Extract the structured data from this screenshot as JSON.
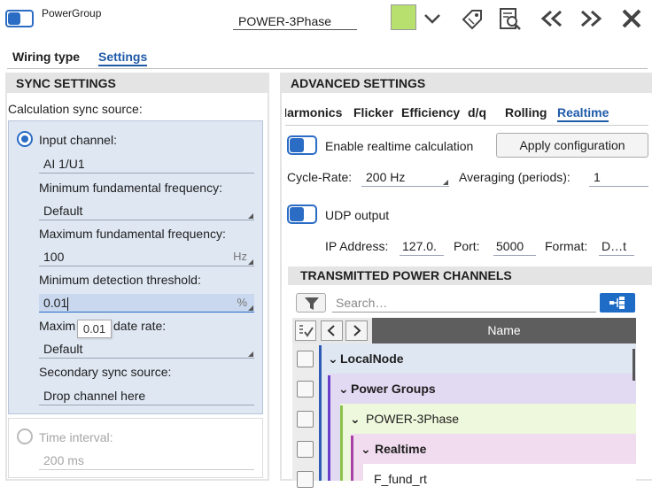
{
  "header": {
    "group_title": "PowerGroup",
    "name_value": "POWER-3Phase",
    "swatch_color": "#b8e06e"
  },
  "tabs": [
    "Wiring type",
    "Settings"
  ],
  "sync": {
    "title": "SYNC SETTINGS",
    "source_label": "Calculation sync source:",
    "input_channel_label": "Input channel:",
    "input_channel_value": "AI 1/U1",
    "min_freq_label": "Minimum fundamental frequency:",
    "min_freq_value": "Default",
    "max_freq_label": "Maximum fundamental frequency:",
    "max_freq_value": "100",
    "max_freq_unit": "Hz",
    "min_thresh_label": "Minimum detection threshold:",
    "min_thresh_value": "0.01",
    "min_thresh_unit": "%",
    "tooltip": "0.01",
    "update_rate_label_a": "Maxim",
    "update_rate_label_b": "date rate:",
    "update_rate_value": "Default",
    "secondary_label": "Secondary sync source:",
    "secondary_value": "Drop channel here",
    "time_interval_label": "Time interval:",
    "time_interval_value": "200 ms"
  },
  "advanced": {
    "title": "ADVANCED SETTINGS",
    "tabs": [
      "Harmonics",
      "Flicker",
      "Efficiency",
      "d/q",
      "Rolling",
      "Realtime"
    ],
    "active_tab": "Realtime",
    "enable_label": "Enable realtime calculation",
    "apply_button": "Apply configuration",
    "cycle_rate_label": "Cycle-Rate:",
    "cycle_rate_value": "200 Hz",
    "averaging_label": "Averaging (periods):",
    "averaging_value": "1",
    "udp_label": "UDP output",
    "ip_label": "IP Address:",
    "ip_value": "127.0.",
    "port_label": "Port:",
    "port_value": "5000",
    "format_label": "Format:",
    "format_value": "D…t"
  },
  "channels": {
    "title": "TRANSMITTED POWER CHANNELS",
    "search_placeholder": "Search…",
    "name_column": "Name",
    "rows": [
      {
        "label": "LocalNode",
        "bold": true,
        "color": "#dfe7f3"
      },
      {
        "label": "Power Groups",
        "bold": true,
        "color": "#e2d9f2"
      },
      {
        "label": "POWER-3Phase",
        "bold": false,
        "color": "#eef8dc"
      },
      {
        "label": "Realtime",
        "bold": true,
        "color": "#f1dcef"
      },
      {
        "label": "F_fund_rt",
        "bold": false,
        "color": "#ffffff"
      }
    ]
  }
}
